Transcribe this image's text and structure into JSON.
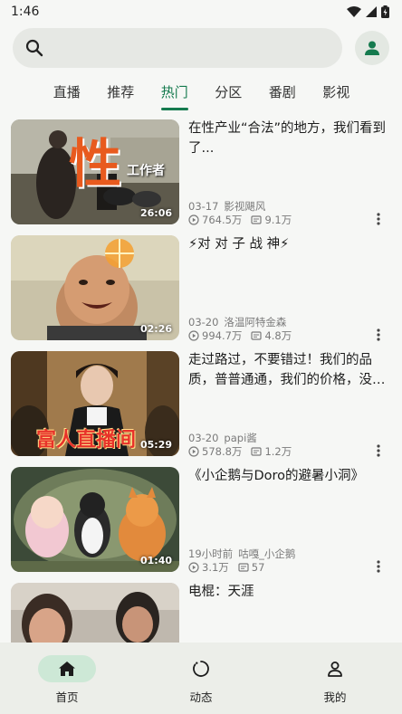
{
  "status": {
    "time": "1:46"
  },
  "search": {
    "placeholder": ""
  },
  "tabs": [
    {
      "label": "直播",
      "active": false
    },
    {
      "label": "推荐",
      "active": false
    },
    {
      "label": "热门",
      "active": true
    },
    {
      "label": "分区",
      "active": false
    },
    {
      "label": "番剧",
      "active": false
    },
    {
      "label": "影视",
      "active": false
    }
  ],
  "videos": [
    {
      "title": "在性产业“合法”的地方，我们看到了...",
      "date": "03-17",
      "uploader": "影视飓风",
      "views": "764.5万",
      "danmaku": "9.1万",
      "duration": "26:06",
      "thumb_text": "性",
      "thumb_subtext": "工作者"
    },
    {
      "title": "⚡对 对 子 战 神⚡",
      "date": "03-20",
      "uploader": "洛温阿特金森",
      "views": "994.7万",
      "danmaku": "4.8万",
      "duration": "02:26"
    },
    {
      "title": "走过路过，不要错过！我们的品质，普普通通，我们的价格，没…",
      "date": "03-20",
      "uploader": "papi酱",
      "views": "578.8万",
      "danmaku": "1.2万",
      "duration": "05:29",
      "thumb_text": "富人直播间"
    },
    {
      "title": "《小企鹅与Doro的避暑小洞》",
      "date": "19小时前",
      "uploader": "咕嘎_小企鹅",
      "views": "3.1万",
      "danmaku": "57",
      "duration": "01:40"
    },
    {
      "title": "电棍：天涯",
      "date": "",
      "uploader": "",
      "views": "",
      "danmaku": "",
      "duration": ""
    }
  ],
  "nav": [
    {
      "label": "首页",
      "icon": "home-icon",
      "active": true
    },
    {
      "label": "动态",
      "icon": "refresh-circle-icon",
      "active": false
    },
    {
      "label": "我的",
      "icon": "person-icon",
      "active": false
    }
  ],
  "colors": {
    "accent": "#157a4e",
    "nav_active_bg": "#cde8d6",
    "search_bg": "#e6e8e4"
  }
}
